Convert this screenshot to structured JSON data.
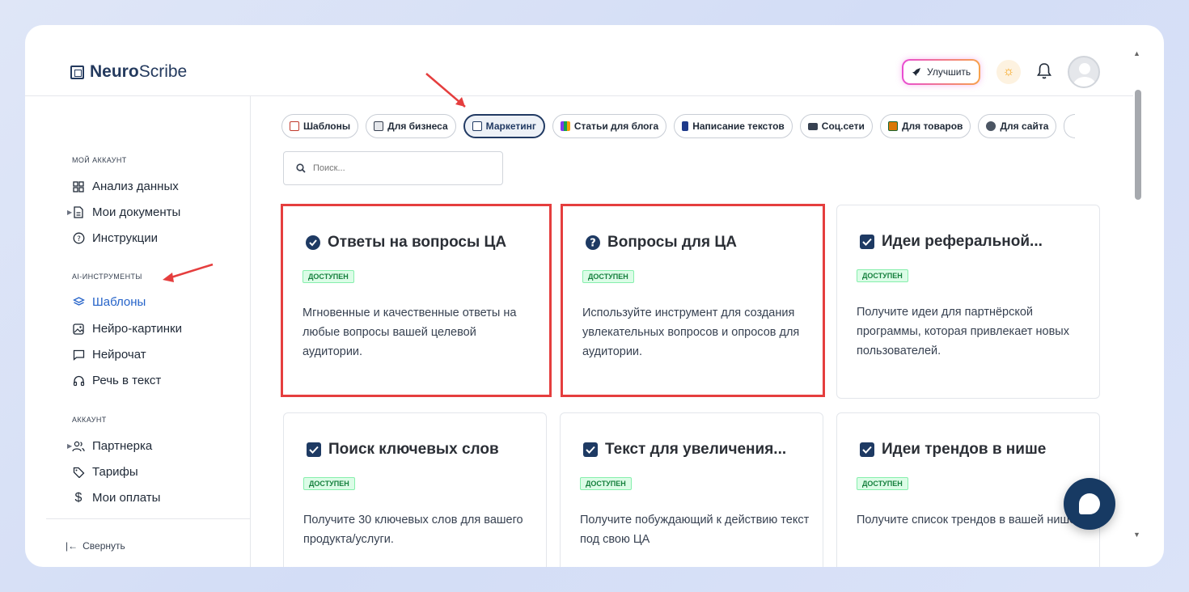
{
  "app": {
    "logo_bold": "Neuro",
    "logo_light": "Scribe"
  },
  "header": {
    "upgrade_label": "Улучшить"
  },
  "sidebar": {
    "section_account": "МОЙ АККАУНТ",
    "section_ai": "AI-ИНСТРУМЕНТЫ",
    "section_acc": "АККАУНТ",
    "items": [
      {
        "label": "Анализ данных"
      },
      {
        "label": "Мои документы"
      },
      {
        "label": "Инструкции"
      },
      {
        "label": "Шаблоны"
      },
      {
        "label": "Нейро-картинки"
      },
      {
        "label": "Нейрочат"
      },
      {
        "label": "Речь в текст"
      },
      {
        "label": "Партнерка"
      },
      {
        "label": "Тарифы"
      },
      {
        "label": "Мои оплаты"
      }
    ],
    "collapse_label": "Свернуть"
  },
  "tabs": [
    {
      "label": "Шаблоны"
    },
    {
      "label": "Для бизнеса"
    },
    {
      "label": "Маркетинг"
    },
    {
      "label": "Статьи для блога"
    },
    {
      "label": "Написание текстов"
    },
    {
      "label": "Соц.сети"
    },
    {
      "label": "Для товаров"
    },
    {
      "label": "Для сайта"
    }
  ],
  "search": {
    "placeholder": "Поиск..."
  },
  "cards": [
    {
      "title": "Ответы на вопросы ЦА",
      "badge": "ДОСТУПЕН",
      "desc": "Мгновенные и качественные ответы на любые вопросы вашей целевой аудитории."
    },
    {
      "title": "Вопросы для ЦА",
      "badge": "ДОСТУПЕН",
      "desc": "Используйте инструмент для создания увлекательных вопросов и опросов для аудитории."
    },
    {
      "title": "Идеи реферальной...",
      "badge": "ДОСТУПЕН",
      "desc": "Получите идеи для партнёрской программы, которая привлекает новых пользователей."
    },
    {
      "title": "Поиск ключевых слов",
      "badge": "ДОСТУПЕН",
      "desc": "Получите 30 ключевых слов для вашего продукта/услуги."
    },
    {
      "title": "Текст для увеличения...",
      "badge": "ДОСТУПЕН",
      "desc": "Получите побуждающий к действию текст под свою ЦА"
    },
    {
      "title": "Идеи трендов в нише",
      "badge": "ДОСТУПЕН",
      "desc": "Получите список трендов в вашей нише"
    }
  ],
  "colors": {
    "accent": "#213a63",
    "highlight": "#e53e3e",
    "badge_green": "#15803d",
    "active_link": "#2563c9"
  }
}
